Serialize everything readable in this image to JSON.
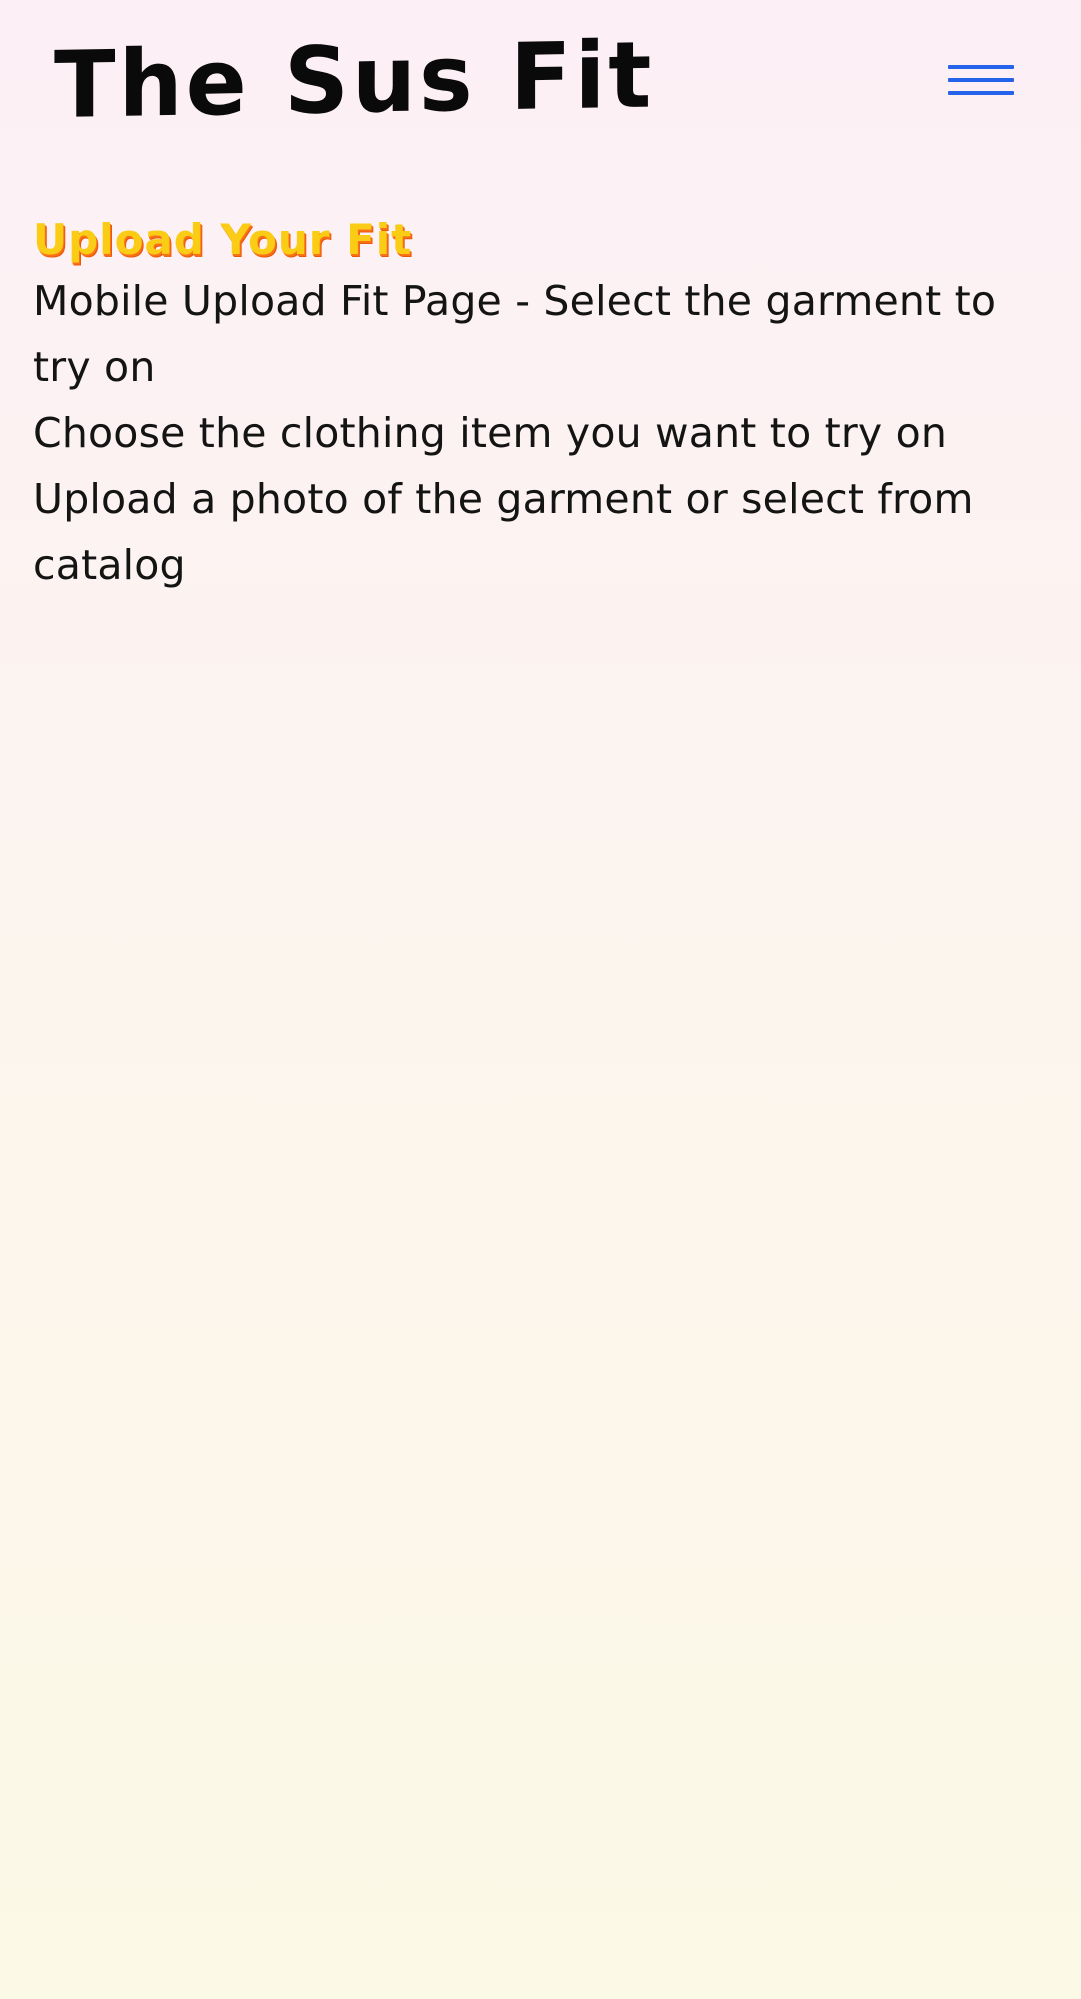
{
  "header": {
    "brand": "The Sus Fit",
    "menu_icon": "hamburger-menu-icon",
    "accent_color": "#2563eb"
  },
  "main": {
    "heading": "Upload Your Fit",
    "heading_color": "#facc15",
    "lines": [
      "Mobile Upload Fit Page - Select the garment to try on",
      "Choose the clothing item you want to try on",
      "Upload a photo of the garment or select from catalog"
    ]
  }
}
